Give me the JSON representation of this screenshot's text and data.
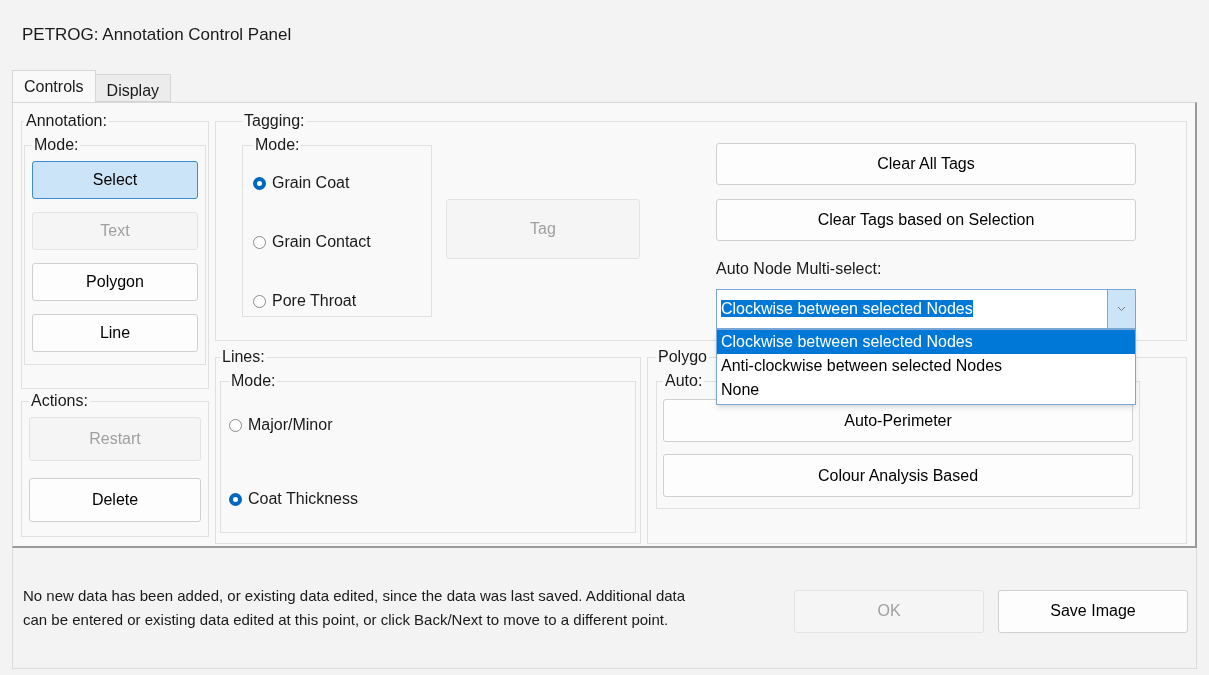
{
  "window": {
    "title": "PETROG: Annotation Control Panel"
  },
  "tabs": [
    {
      "label": "Controls",
      "selected": true
    },
    {
      "label": "Display",
      "selected": false
    }
  ],
  "annotation": {
    "label": "Annotation:",
    "mode_label": "Mode:",
    "mode_buttons": [
      {
        "label": "Select",
        "selected": true,
        "disabled": false
      },
      {
        "label": "Text",
        "selected": false,
        "disabled": true
      },
      {
        "label": "Polygon",
        "selected": false,
        "disabled": false
      },
      {
        "label": "Line",
        "selected": false,
        "disabled": false
      }
    ],
    "actions_label": "Actions:",
    "action_buttons": [
      {
        "label": "Restart",
        "disabled": true
      },
      {
        "label": "Delete",
        "disabled": false
      }
    ]
  },
  "tagging": {
    "label": "Tagging:",
    "mode_label": "Mode:",
    "modes": [
      {
        "label": "Grain Coat",
        "selected": true
      },
      {
        "label": "Grain Contact",
        "selected": false
      },
      {
        "label": "Pore Throat",
        "selected": false
      }
    ],
    "tag_button": {
      "label": "Tag",
      "disabled": true
    },
    "buttons": [
      {
        "label": "Clear All Tags",
        "disabled": false
      },
      {
        "label": "Clear Tags based on Selection",
        "disabled": false
      }
    ],
    "auto_node_label": "Auto Node Multi-select:",
    "auto_node_select": {
      "value": "Clockwise between selected Nodes",
      "expanded": true,
      "options": [
        {
          "label": "Clockwise between selected Nodes",
          "selected": true
        },
        {
          "label": "Anti-clockwise between selected Nodes",
          "selected": false
        },
        {
          "label": "None",
          "selected": false
        }
      ]
    }
  },
  "lines": {
    "label": "Lines:",
    "mode_label": "Mode:",
    "modes": [
      {
        "label": "Major/Minor",
        "selected": false
      },
      {
        "label": "Coat Thickness",
        "selected": true
      }
    ]
  },
  "polygon": {
    "label": "Polygo",
    "auto_label": "Auto:",
    "buttons": [
      {
        "label": "Auto-Perimeter",
        "disabled": false
      },
      {
        "label": "Colour Analysis Based",
        "disabled": false
      }
    ]
  },
  "status": {
    "message": "No new data has been added, or existing data edited, since the data was last saved.  Additional data can be entered or existing data edited at this point, or click Back/Next to move to a different point.",
    "buttons": [
      {
        "label": "OK",
        "disabled": true
      },
      {
        "label": "Save Image",
        "disabled": false
      }
    ]
  }
}
